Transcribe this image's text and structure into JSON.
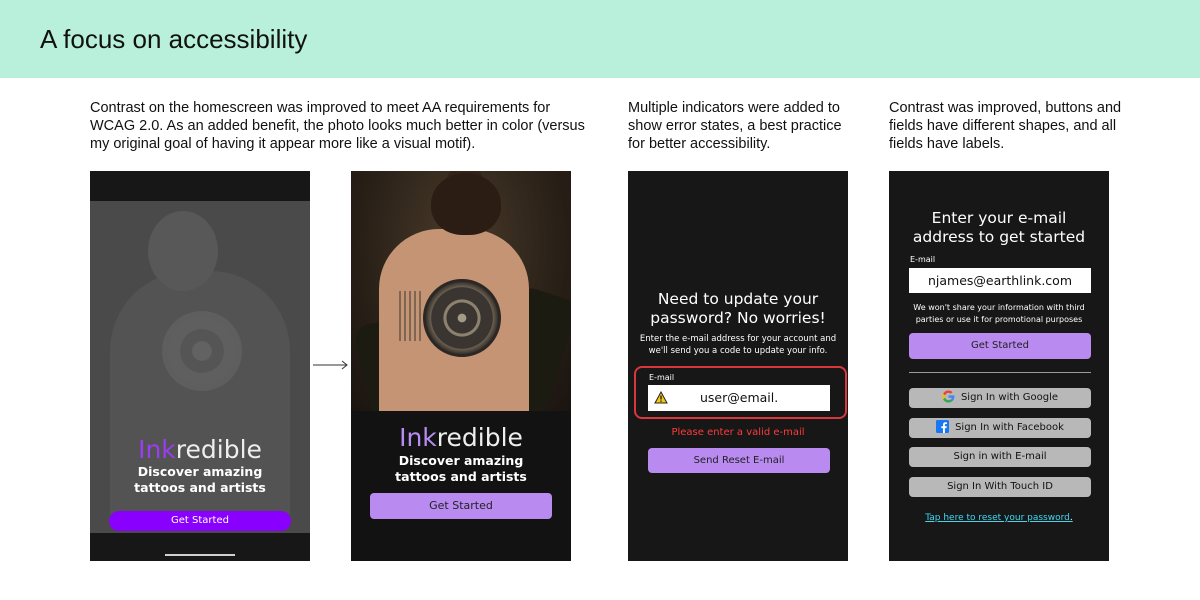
{
  "header": {
    "title": "A focus on accessibility"
  },
  "descriptions": {
    "homescreen": "Contrast on the homescreen was improved to meet AA requirements for WCAG 2.0. As an added benefit, the photo looks much better in color (versus my original goal of having it appear more like a visual motif).",
    "errors": "Multiple indicators were added to show error states, a best practice for better accessibility.",
    "fields": "Contrast was improved, buttons and fields have different shapes, and all fields have labels."
  },
  "before_screen": {
    "logo_ink": "Ink",
    "logo_rest": "redible",
    "tagline_line1": "Discover amazing",
    "tagline_line2": "tattoos and artists",
    "button": "Get Started",
    "logo_ink_color": "#9a3cf0",
    "button_color": "#8a00ff"
  },
  "after_screen": {
    "logo_ink": "Ink",
    "logo_rest": "redible",
    "tagline_line1": "Discover amazing",
    "tagline_line2": "tattoos and artists",
    "button": "Get Started",
    "logo_ink_color": "#b58cf2",
    "button_color": "#b98af0"
  },
  "error_screen": {
    "title_line1": "Need to update your",
    "title_line2": "password? No worries!",
    "subtitle_line1": "Enter the e-mail address for your account and",
    "subtitle_line2": "we'll send you a code to update your info.",
    "email_label": "E-mail",
    "email_value": "user@email.",
    "warning_icon": "warning-triangle-icon",
    "error_message": "Please enter a valid e-mail",
    "button": "Send Reset E-mail",
    "error_color": "#d9373b"
  },
  "signin_screen": {
    "title_line1": "Enter your e-mail",
    "title_line2": "address to get started",
    "email_label": "E-mail",
    "email_value": "njames@earthlink.com",
    "note_line1": "We won't share your information with third",
    "note_line2": "parties or use it for promotional purposes",
    "primary_button": "Get Started",
    "google_button": "Sign In with Google",
    "facebook_button": "Sign In with Facebook",
    "email_button": "Sign in with E-mail",
    "touchid_button": "Sign In With Touch ID",
    "reset_link": "Tap here to reset your password",
    "reset_link_suffix": ".",
    "link_color": "#3fd8f0"
  }
}
